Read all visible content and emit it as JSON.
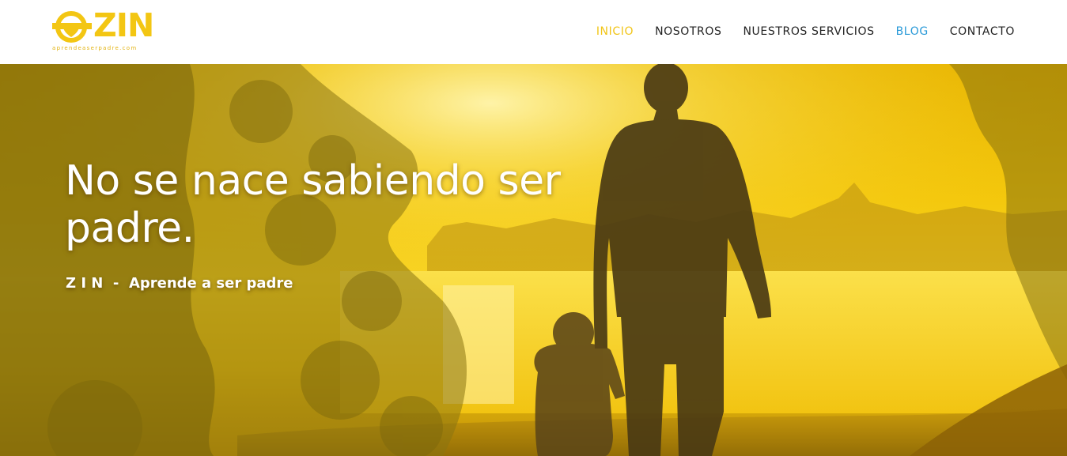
{
  "header": {
    "logo": {
      "wordmark": "ZIN",
      "tagline": "aprendeaserpadre.com"
    },
    "nav": {
      "items": [
        {
          "label": "INICIO",
          "state": "active"
        },
        {
          "label": "NOSOTROS",
          "state": "default"
        },
        {
          "label": "NUESTROS SERVICIOS",
          "state": "default"
        },
        {
          "label": "BLOG",
          "state": "highlight"
        },
        {
          "label": "CONTACTO",
          "state": "default"
        }
      ]
    }
  },
  "hero": {
    "title": "No se nace sabiendo ser padre.",
    "subtitle_brand": "Z I N",
    "subtitle_separator": "-",
    "subtitle_text": "Aprende a ser padre"
  },
  "colors": {
    "brand_yellow": "#f3c613",
    "nav_active": "#f1c517",
    "nav_blog": "#2a9ad8",
    "nav_default": "#222222"
  },
  "icons": {
    "logo_mark": "heart-face-icon"
  }
}
